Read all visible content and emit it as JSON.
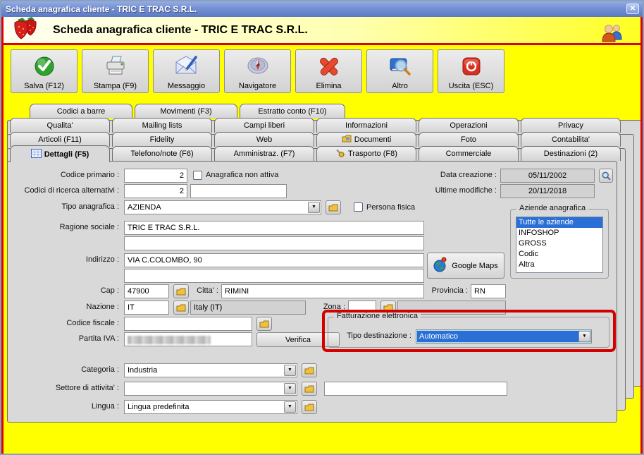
{
  "titlebar": {
    "title": "Scheda anagrafica cliente - TRIC E TRAC S.R.L.",
    "close_glyph": "✕"
  },
  "header": {
    "title": "Scheda anagrafica cliente - TRIC E TRAC S.R.L."
  },
  "toolbar": {
    "buttons": [
      {
        "label": "Salva (F12)",
        "icon": "save-check-icon"
      },
      {
        "label": "Stampa (F9)",
        "icon": "printer-icon"
      },
      {
        "label": "Messaggio",
        "icon": "message-icon"
      },
      {
        "label": "Navigatore",
        "icon": "compass-icon"
      },
      {
        "label": "Elimina",
        "icon": "delete-x-icon"
      },
      {
        "label": "Altro",
        "icon": "book-search-icon"
      },
      {
        "label": "Uscita (ESC)",
        "icon": "power-icon"
      }
    ]
  },
  "tabs": {
    "row1": [
      "Codici a barre",
      "Movimenti (F3)",
      "Estratto conto (F10)"
    ],
    "row2": [
      "Qualita'",
      "Mailing lists",
      "Campi liberi",
      "Informazioni",
      "Operazioni",
      "Privacy"
    ],
    "row3": [
      "Articoli (F11)",
      "Fidelity",
      "Web",
      "Documenti",
      "Foto",
      "Contabilita'"
    ],
    "row4": [
      "Dettagli (F5)",
      "Telefono/note (F6)",
      "Amministraz. (F7)",
      "Trasporto (F8)",
      "Commerciale",
      "Destinazioni (2)"
    ],
    "active": "Dettagli (F5)"
  },
  "form": {
    "codice_primario": {
      "label": "Codice primario :",
      "value": "2"
    },
    "anagrafica_non_attiva": {
      "label": "Anagrafica non attiva",
      "checked": false
    },
    "codici_ricerca": {
      "label": "Codici di ricerca alternativi :",
      "value": "2",
      "alt_value": ""
    },
    "tipo_anagrafica": {
      "label": "Tipo anagrafica :",
      "value": "AZIENDA"
    },
    "persona_fisica": {
      "label": "Persona fisica",
      "checked": false
    },
    "data_creazione": {
      "label": "Data creazione :",
      "value": "05/11/2002"
    },
    "ultime_modifiche": {
      "label": "Ultime modifiche :",
      "value": "20/11/2018"
    },
    "ragione_sociale": {
      "label": "Ragione sociale :",
      "value": "TRIC E TRAC S.R.L.",
      "value2": ""
    },
    "indirizzo": {
      "label": "Indirizzo :",
      "value": "VIA C.COLOMBO, 90",
      "value2": ""
    },
    "google_maps_button": "Google Maps",
    "cap": {
      "label": "Cap :",
      "value": "47900"
    },
    "citta": {
      "label": "Citta' :",
      "value": "RIMINI"
    },
    "provincia": {
      "label": "Provincia :",
      "value": "RN"
    },
    "nazione": {
      "label": "Nazione :",
      "value": "IT",
      "descr": "Italy (IT)"
    },
    "zona": {
      "label": "Zona :",
      "value": "",
      "descr": ""
    },
    "codice_fiscale": {
      "label": "Codice fiscale :",
      "value": ""
    },
    "partita_iva": {
      "label": "Partita IVA :",
      "censored": true
    },
    "verifica_button": "Verifica",
    "categoria": {
      "label": "Categoria :",
      "value": "Industria"
    },
    "settore": {
      "label": "Settore di attivita' :",
      "value": "",
      "extra": ""
    },
    "lingua": {
      "label": "Lingua :",
      "value": "Lingua predefinita"
    }
  },
  "aziende": {
    "legend": "Aziende anagrafica",
    "items": [
      "Tutte le aziende",
      "INFOSHOP",
      "GROSS",
      "Codic",
      "Altra"
    ],
    "selected": "Tutte le aziende"
  },
  "fatturazione": {
    "legend": "Fatturazione elettronica",
    "tipo_destinazione_label": "Tipo destinazione :",
    "tipo_destinazione_value": "Automatico"
  },
  "colors": {
    "highlight_red": "#d40000",
    "selection_blue": "#2a6fd6",
    "background_yellow": "#ffff00",
    "titlebar_blue": "#5b79c4",
    "panel_gray": "#d9d9d9"
  }
}
